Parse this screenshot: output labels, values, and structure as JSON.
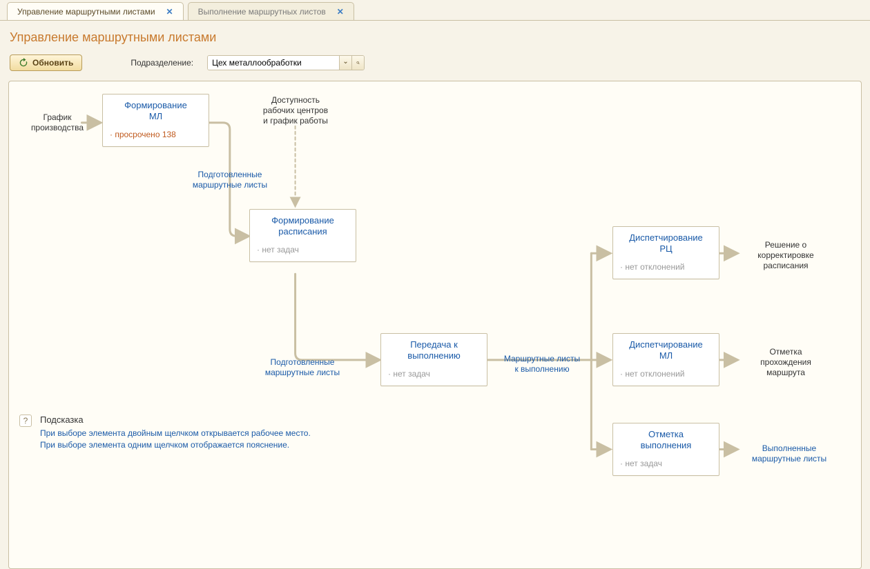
{
  "tabs": [
    {
      "label": "Управление маршрутными листами",
      "active": true
    },
    {
      "label": "Выполнение маршрутных листов",
      "active": false
    }
  ],
  "page_title": "Управление маршрутными листами",
  "toolbar": {
    "refresh_label": "Обновить",
    "department_label": "Подразделение:",
    "department_value": "Цех металлообработки"
  },
  "labels": {
    "production_schedule": "График\nпроизводства",
    "avail_rc": "Доступность\nрабочих центров\nи график работы",
    "prepared_ml_1": "Подготовленные\nмаршрутные листы",
    "prepared_ml_2": "Подготовленные\nмаршрутные листы",
    "ml_to_exec": "Маршрутные листы\nк выполнению",
    "decision": "Решение о\nкорректировке\nрасписания",
    "mark_route": "Отметка\nпрохождения\nмаршрута",
    "done_ml": "Выполненные\nмаршрутные листы"
  },
  "nodes": {
    "form_ml": {
      "title": "Формирование\nМЛ",
      "status": "· просрочено 138",
      "warn": true
    },
    "form_sched": {
      "title": "Формирование\nрасписания",
      "status": "· нет задач"
    },
    "transfer": {
      "title": "Передача к\nвыполнению",
      "status": "· нет задач"
    },
    "disp_rc": {
      "title": "Диспетчирование\nРЦ",
      "status": "· нет отклонений"
    },
    "disp_ml": {
      "title": "Диспетчирование\nМЛ",
      "status": "· нет отклонений"
    },
    "mark_done": {
      "title": "Отметка\nвыполнения",
      "status": "· нет задач"
    }
  },
  "hint": {
    "title": "Подсказка",
    "line1": "При выборе элемента двойным щелчком открывается рабочее место.",
    "line2": "При выборе элемента одним щелчком отображается пояснение."
  }
}
